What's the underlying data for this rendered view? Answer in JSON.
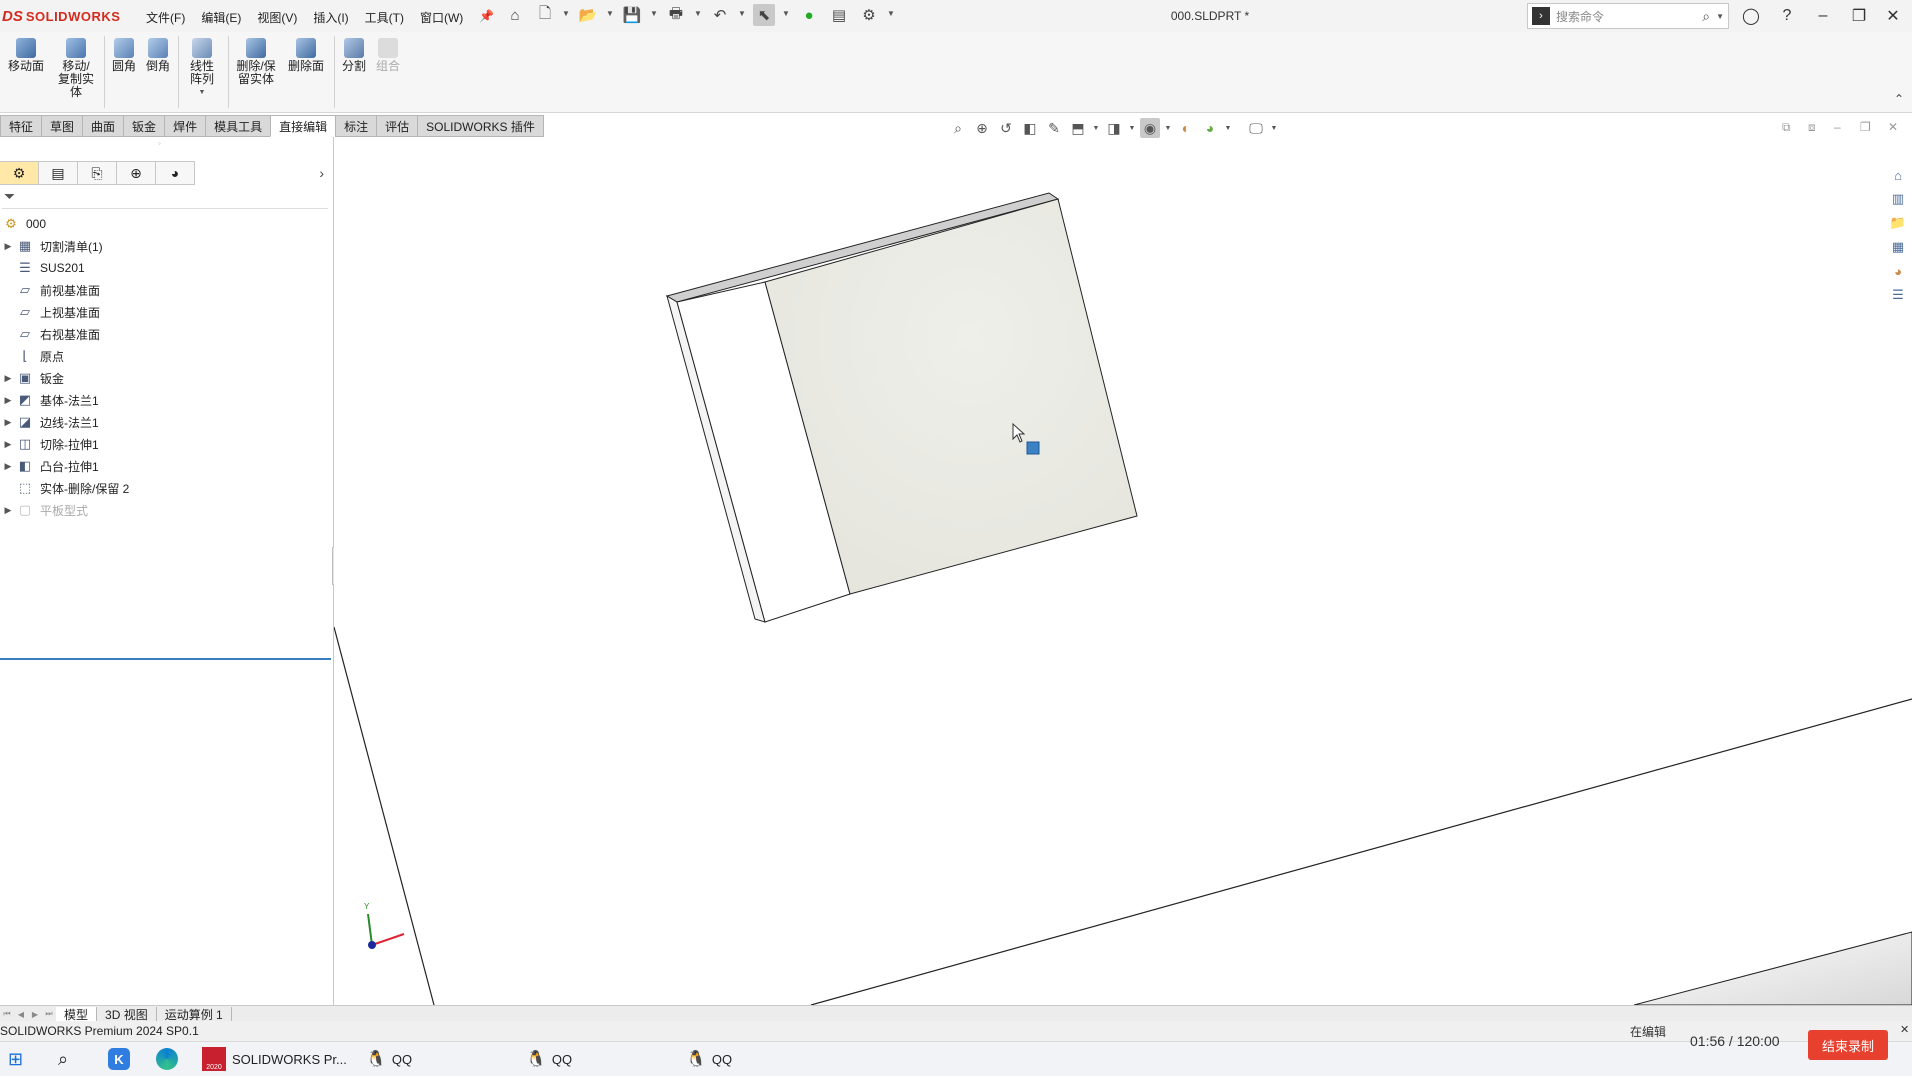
{
  "app": {
    "brand": "SOLIDWORKS",
    "brand_prefix": "DS",
    "document_title": "000.SLDPRT *",
    "menus": [
      "文件(F)",
      "编辑(E)",
      "视图(V)",
      "插入(I)",
      "工具(T)",
      "窗口(W)"
    ],
    "search_placeholder": "搜索命令"
  },
  "ribbon": {
    "buttons": [
      {
        "label": "移动面"
      },
      {
        "label": "移动/复制实体"
      },
      {
        "label": "圆角"
      },
      {
        "label": "倒角"
      },
      {
        "label": "线性阵列"
      },
      {
        "label": "删除/保留实体"
      },
      {
        "label": "删除面"
      },
      {
        "label": "分割"
      },
      {
        "label": "组合"
      }
    ]
  },
  "tabs": [
    "特征",
    "草图",
    "曲面",
    "钣金",
    "焊件",
    "模具工具",
    "直接编辑",
    "标注",
    "评估",
    "SOLIDWORKS 插件"
  ],
  "active_tab": "直接编辑",
  "feature_tree": {
    "root": "000",
    "items": [
      {
        "label": "切割清单(1)",
        "expandable": true
      },
      {
        "label": "SUS201",
        "expandable": false
      },
      {
        "label": "前视基准面",
        "expandable": false
      },
      {
        "label": "上视基准面",
        "expandable": false
      },
      {
        "label": "右视基准面",
        "expandable": false
      },
      {
        "label": "原点",
        "expandable": false
      },
      {
        "label": "钣金",
        "expandable": true
      },
      {
        "label": "基体-法兰1",
        "expandable": true
      },
      {
        "label": "边线-法兰1",
        "expandable": true
      },
      {
        "label": "切除-拉伸1",
        "expandable": true
      },
      {
        "label": "凸台-拉伸1",
        "expandable": true
      },
      {
        "label": "实体-删除/保留 2",
        "expandable": false
      },
      {
        "label": "平板型式",
        "expandable": true
      }
    ]
  },
  "model_tabs": [
    "模型",
    "3D 视图",
    "运动算例 1"
  ],
  "statusbar": {
    "product": "SOLIDWORKS Premium 2024 SP0.1",
    "mode": "在编辑"
  },
  "recorder": {
    "time": "01:56 / 120:00",
    "stop_label": "结束录制"
  },
  "taskbar": {
    "apps": [
      {
        "label": "SOLIDWORKS Pr..."
      },
      {
        "label": "QQ"
      },
      {
        "label": "QQ"
      },
      {
        "label": "QQ"
      }
    ],
    "sw_badge": "2020"
  },
  "triad": {
    "y_label": "Y"
  },
  "colors": {
    "brand": "#d52b1e",
    "record_button": "#e8402f",
    "selection_accent": "#3a7cbc",
    "face_fill": "#e9e9e3"
  }
}
